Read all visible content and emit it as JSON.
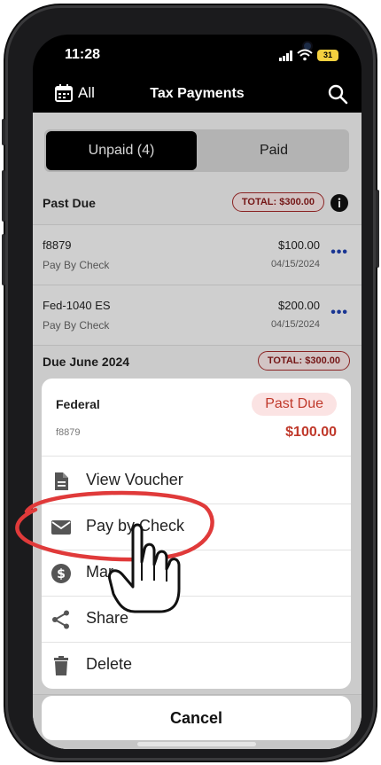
{
  "status_bar": {
    "time": "11:28",
    "battery": "31"
  },
  "nav": {
    "filter_label": "All",
    "title": "Tax Payments"
  },
  "segments": [
    {
      "label": "Unpaid (4)",
      "active": true
    },
    {
      "label": "Paid",
      "active": false
    }
  ],
  "past_due": {
    "label": "Past Due",
    "total": "TOTAL: $300.00"
  },
  "rows": [
    {
      "name": "f8879",
      "method": "Pay By Check",
      "amount": "$100.00",
      "date": "04/15/2024"
    },
    {
      "name": "Fed-1040 ES",
      "method": "Pay By Check",
      "amount": "$200.00",
      "date": "04/15/2024"
    }
  ],
  "due_june": {
    "label": "Due June 2024",
    "total": "TOTAL: $300.00"
  },
  "sheet": {
    "agency": "Federal",
    "form": "f8879",
    "status": "Past Due",
    "amount": "$100.00",
    "actions": [
      {
        "label": "View Voucher",
        "icon": "document-icon"
      },
      {
        "label": "Pay by Check",
        "icon": "envelope-icon"
      },
      {
        "label": "Mar",
        "icon": "dollar-circle-icon"
      },
      {
        "label": "Share",
        "icon": "share-icon"
      },
      {
        "label": "Delete",
        "icon": "trash-icon"
      }
    ],
    "cancel": "Cancel"
  },
  "colors": {
    "accent_red": "#c0392b",
    "highlight_circle": "#e03a3a",
    "more_dots": "#1e40af"
  }
}
